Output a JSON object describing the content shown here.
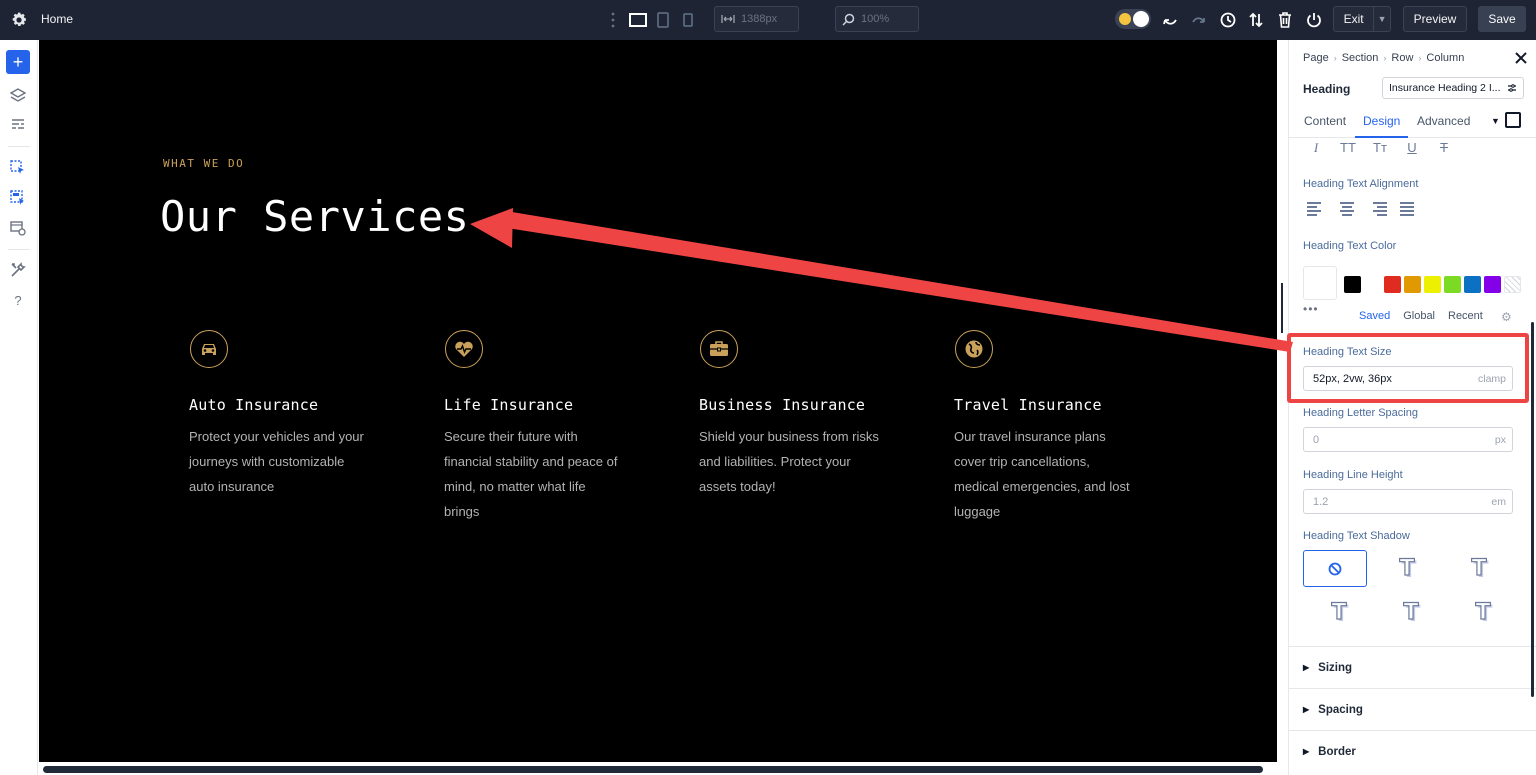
{
  "topbar": {
    "page_name": "Home",
    "width_value": "1388px",
    "zoom_value": "100%",
    "exit_label": "Exit",
    "preview_label": "Preview",
    "save_label": "Save"
  },
  "canvas": {
    "eyebrow": "WHAT WE DO",
    "title": "Our Services",
    "accent_color": "#c9a15a",
    "services": [
      {
        "icon": "car-icon",
        "title": "Auto Insurance",
        "description": "Protect your vehicles and your journeys with customizable auto insurance"
      },
      {
        "icon": "heart-pulse-icon",
        "title": "Life Insurance",
        "description": "Secure their future with financial stability and peace of mind, no matter what life brings"
      },
      {
        "icon": "briefcase-icon",
        "title": "Business Insurance",
        "description": "Shield your business from risks and liabilities. Protect your assets today!"
      },
      {
        "icon": "globe-icon",
        "title": "Travel Insurance",
        "description": "Our travel insurance plans cover trip cancellations, medical emergencies, and lost luggage"
      }
    ]
  },
  "panel": {
    "breadcrumbs": [
      "Page",
      "Section",
      "Row",
      "Column"
    ],
    "module_label": "Heading",
    "module_preset": "Insurance Heading 2 I...",
    "tabs": [
      "Content",
      "Design",
      "Advanced"
    ],
    "active_tab": "Design",
    "alignment_label": "Heading Text Alignment",
    "color_label": "Heading Text Color",
    "swatch_colors": [
      "#000000",
      "#ffffff",
      "#e02b20",
      "#e09900",
      "#edf000",
      "#7cda24",
      "#0c71c3",
      "#8300e9"
    ],
    "color_tabs": [
      "Saved",
      "Global",
      "Recent"
    ],
    "size_label": "Heading Text Size",
    "size_value": "52px, 2vw, 36px",
    "size_unit": "clamp",
    "letter_spacing_label": "Heading Letter Spacing",
    "letter_spacing_value": "0",
    "letter_spacing_unit": "px",
    "line_height_label": "Heading Line Height",
    "line_height_value": "1.2",
    "line_height_unit": "em",
    "shadow_label": "Heading Text Shadow",
    "sections": [
      "Sizing",
      "Spacing",
      "Border"
    ]
  },
  "colors": {
    "topbar_bg": "#1e2433",
    "accent_blue": "#2563eb",
    "highlight_red": "#ef4444"
  }
}
